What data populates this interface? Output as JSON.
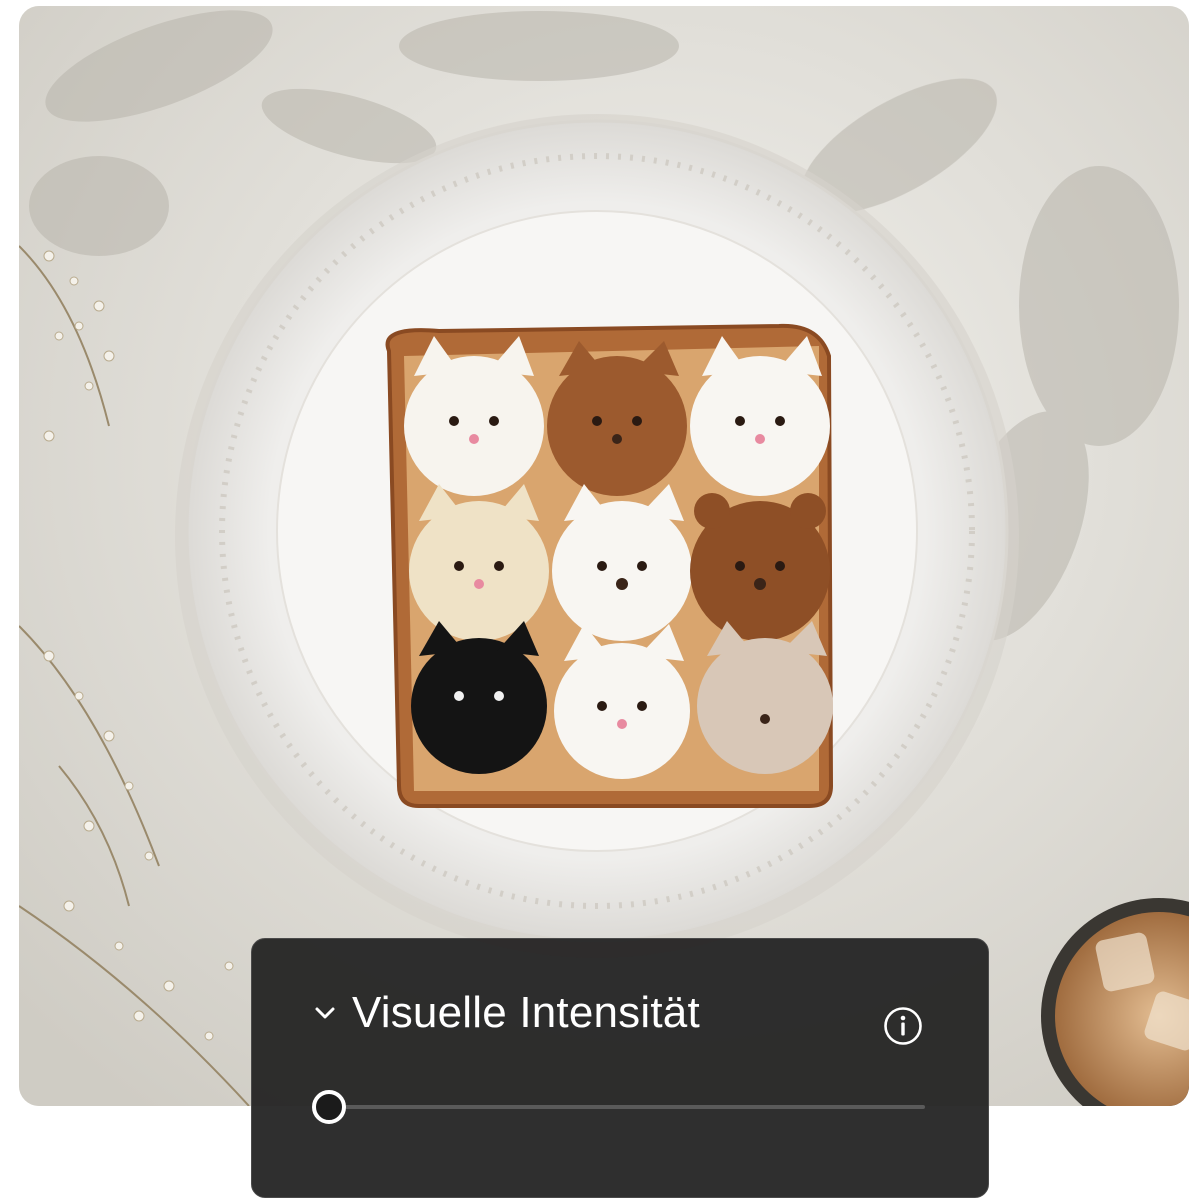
{
  "photo": {
    "subject": "toast-with-cat-faces",
    "icon": "photo-image"
  },
  "panel": {
    "title": "Visuelle Intensität",
    "collapse_icon": "chevron-down-icon",
    "info_icon": "info-icon",
    "slider": {
      "value": 0.0
    }
  },
  "colors": {
    "panel_bg": "#222222",
    "track": "#5a5a5a",
    "thumb_border": "#ffffff"
  }
}
